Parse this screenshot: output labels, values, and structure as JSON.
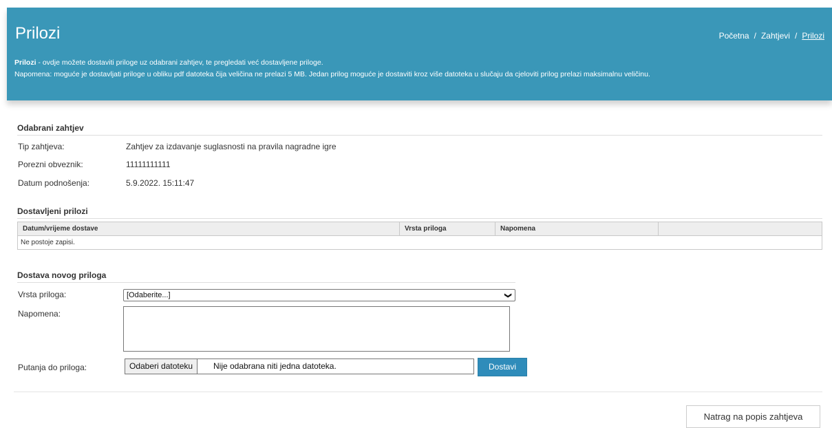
{
  "header": {
    "title": "Prilozi",
    "breadcrumbs": [
      "Početna",
      "Zahtjevi",
      "Prilozi"
    ],
    "intro_bold": "Prilozi",
    "intro_rest": " - ovdje možete dostaviti priloge uz odabrani zahtjev, te pregledati već dostavljene priloge.",
    "note": "Napomena: moguće je dostavljati priloge u obliku pdf datoteka čija veličina ne prelazi 5 MB. Jedan prilog moguće je dostaviti kroz više datoteka u slučaju da cjeloviti prilog prelazi maksimalnu veličinu."
  },
  "selected_request": {
    "title": "Odabrani zahtjev",
    "rows": [
      {
        "label": "Tip zahtjeva:",
        "value": "Zahtjev za izdavanje suglasnosti na pravila nagradne igre"
      },
      {
        "label": "Porezni obveznik:",
        "value": "11111111111"
      },
      {
        "label": "Datum podnošenja:",
        "value": "5.9.2022. 15:11:47"
      }
    ]
  },
  "delivered": {
    "title": "Dostavljeni prilozi",
    "columns": [
      "Datum/vrijeme dostave",
      "Vrsta priloga",
      "Napomena",
      ""
    ],
    "empty_text": "Ne postoje zapisi."
  },
  "new_attachment": {
    "title": "Dostava novog priloga",
    "type_label": "Vrsta priloga:",
    "type_value": "[Odaberite...]",
    "note_label": "Napomena:",
    "path_label": "Putanja do priloga:",
    "file_button": "Odaberi datoteku",
    "file_status": "Nije odabrana niti jedna datoteka.",
    "submit_label": "Dostavi"
  },
  "back_button": "Natrag na popis zahtjeva"
}
